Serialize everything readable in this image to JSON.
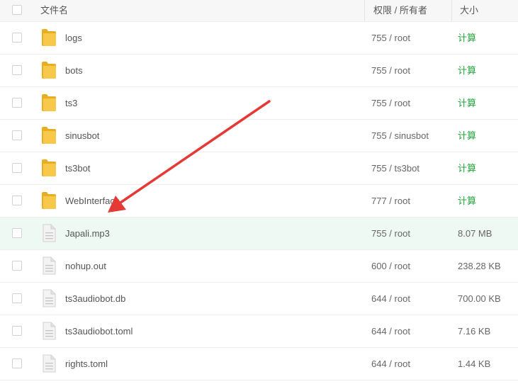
{
  "header": {
    "name_label": "文件名",
    "perm_label": "权限 / 所有者",
    "size_label": "大小"
  },
  "colors": {
    "calc_link": "#20a53a",
    "folder": "#f5c344",
    "highlight_row": "#eef9f3",
    "annotation_arrow": "#e53935"
  },
  "rows": [
    {
      "name": "logs",
      "type": "folder",
      "perm": "755 / root",
      "size": "计算"
    },
    {
      "name": "bots",
      "type": "folder",
      "perm": "755 / root",
      "size": "计算"
    },
    {
      "name": "ts3",
      "type": "folder",
      "perm": "755 / root",
      "size": "计算"
    },
    {
      "name": "sinusbot",
      "type": "folder",
      "perm": "755 / sinusbot",
      "size": "计算"
    },
    {
      "name": "ts3bot",
      "type": "folder",
      "perm": "755 / ts3bot",
      "size": "计算"
    },
    {
      "name": "WebInterface",
      "type": "folder",
      "perm": "777 / root",
      "size": "计算"
    },
    {
      "name": "Japali.mp3",
      "type": "file",
      "perm": "755 / root",
      "size": "8.07 MB",
      "highlighted": true
    },
    {
      "name": "nohup.out",
      "type": "file",
      "perm": "600 / root",
      "size": "238.28 KB"
    },
    {
      "name": "ts3audiobot.db",
      "type": "file",
      "perm": "644 / root",
      "size": "700.00 KB"
    },
    {
      "name": "ts3audiobot.toml",
      "type": "file",
      "perm": "644 / root",
      "size": "7.16 KB"
    },
    {
      "name": "rights.toml",
      "type": "file",
      "perm": "644 / root",
      "size": "1.44 KB"
    }
  ],
  "annotation": {
    "icon": "red-arrow-icon",
    "points_to": "Japali.mp3"
  }
}
